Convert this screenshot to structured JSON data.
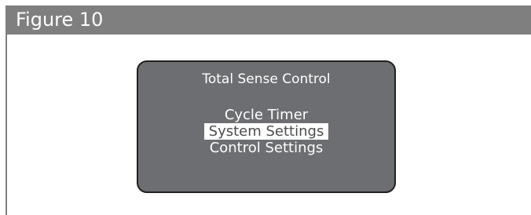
{
  "figure": {
    "title": "Figure 10"
  },
  "screen": {
    "title": "Total Sense Control",
    "menu": {
      "items": [
        {
          "label": "Cycle Timer",
          "selected": false
        },
        {
          "label": "System Settings",
          "selected": true
        },
        {
          "label": "Control Settings",
          "selected": false
        }
      ]
    }
  },
  "colors": {
    "header_background": "#7f7f80",
    "screen_background": "#6d6e71",
    "screen_border": "#231f20",
    "text": "#ffffff",
    "selection_background": "#ffffff",
    "selection_text": "#4d4d4f"
  }
}
